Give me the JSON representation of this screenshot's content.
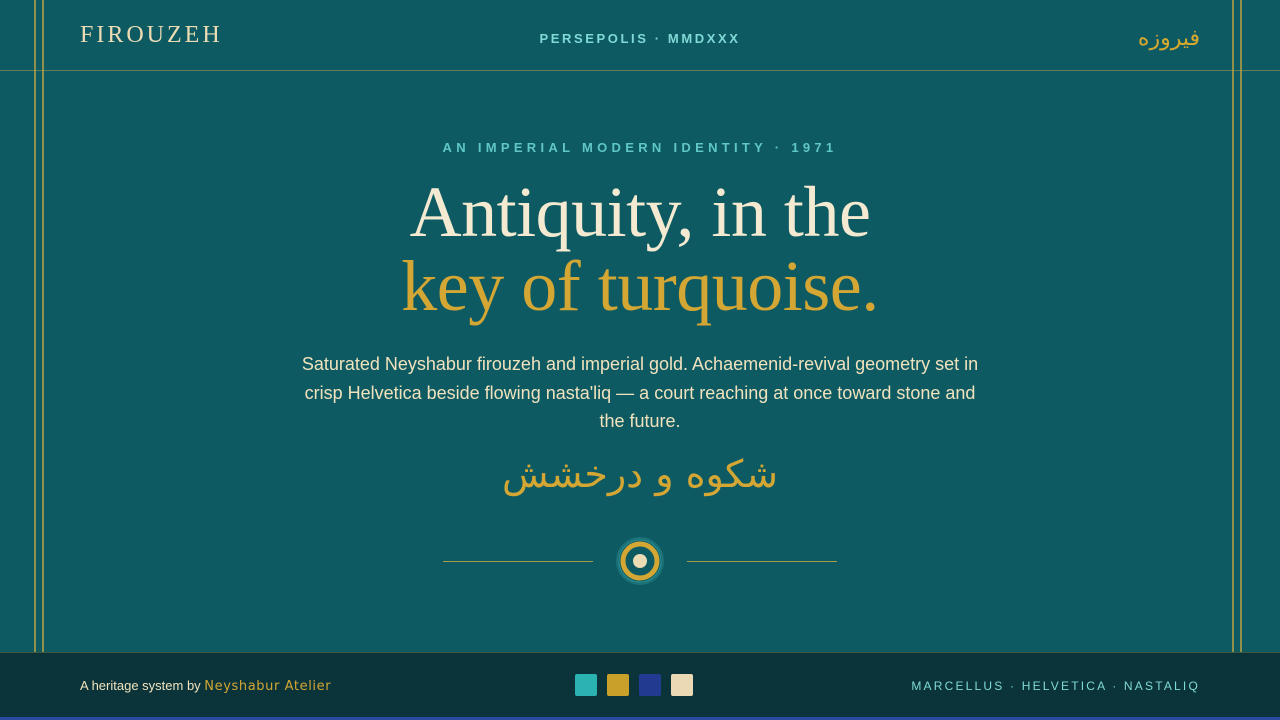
{
  "header": {
    "brand": "FIROUZEH",
    "center": "PERSEPOLIS · MMDXXX",
    "right_script": "فیروزه"
  },
  "hero": {
    "eyebrow": "AN IMPERIAL MODERN IDENTITY · 1971",
    "title_line1": "Antiquity, in the",
    "title_line2": "key of turquoise.",
    "lede": "Saturated Neyshabur firouzeh and imperial gold. Achaemenid-revival geometry set in crisp Helvetica beside flowing nasta'liq — a court reaching at once toward stone and the future.",
    "calligraphy": "شکوه و درخشش"
  },
  "footer": {
    "credit_prefix": "A heritage system by",
    "credit_name": "Neyshabur Atelier",
    "swatches": [
      {
        "name": "turquoise-swatch",
        "color": "#2ab3b0"
      },
      {
        "name": "gold-swatch",
        "color": "#c9a02a"
      },
      {
        "name": "lapis-swatch",
        "color": "#233a91"
      },
      {
        "name": "ivory-swatch",
        "color": "#ead9b4"
      }
    ],
    "fonts": "MARCELLUS · HELVETICA · NASTALIQ"
  },
  "colors": {
    "background": "#0e5a62",
    "gold": "#d4a633",
    "ivory": "#f3ead1",
    "turquoise_text": "#7fd9d6",
    "footer_bg": "#0a343a"
  }
}
